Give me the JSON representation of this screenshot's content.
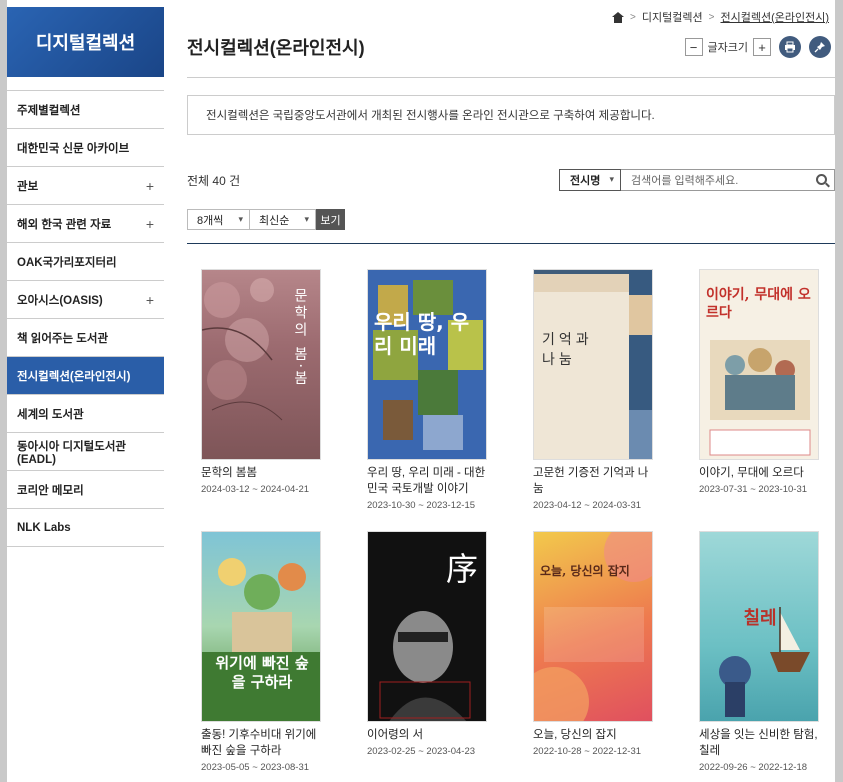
{
  "logo": "디지털컬렉션",
  "sidebar": {
    "items": [
      {
        "label": "주제별컬렉션",
        "plus": ""
      },
      {
        "label": "대한민국 신문 아카이브",
        "plus": ""
      },
      {
        "label": "관보",
        "plus": "+"
      },
      {
        "label": "해외 한국 관련 자료",
        "plus": "+"
      },
      {
        "label": "OAK국가리포지터리",
        "plus": ""
      },
      {
        "label": "오아시스(OASIS)",
        "plus": "+"
      },
      {
        "label": "책 읽어주는 도서관",
        "plus": ""
      },
      {
        "label": "전시컬렉션(온라인전시)",
        "plus": ""
      },
      {
        "label": "세계의 도서관",
        "plus": ""
      },
      {
        "label": "동아시아 디지털도서관(EADL)",
        "plus": ""
      },
      {
        "label": "코리안 메모리",
        "plus": ""
      },
      {
        "label": "NLK Labs",
        "plus": ""
      }
    ]
  },
  "breadcrumb": {
    "items": [
      "디지털컬렉션",
      "전시컬렉션(온라인전시)"
    ],
    "sep": ">"
  },
  "page": {
    "title": "전시컬렉션(온라인전시)",
    "font_size_label": "글자크기",
    "minus": "−",
    "plus": "+",
    "notice": "전시컬렉션은 국립중앙도서관에서 개최된 전시행사를 온라인 전시관으로 구축하여 제공합니다.",
    "total": "전체 40 건"
  },
  "search": {
    "field": "전시명",
    "placeholder": "검색어를 입력해주세요."
  },
  "filters": {
    "per_page": "8개씩",
    "sort": "최신순",
    "view": "보기"
  },
  "exhibits": [
    {
      "title": "문학의 봄봄",
      "dates": "2024-03-12 ~ 2024-04-21",
      "poster": "문학의 봄·봄"
    },
    {
      "title": "우리 땅, 우리 미래 - 대한민국 국토개발 이야기",
      "dates": "2023-10-30 ~ 2023-12-15",
      "poster": "우리 땅, 우리 미래"
    },
    {
      "title": "고문헌 기증전 기억과 나눔",
      "dates": "2023-04-12 ~ 2024-03-31",
      "poster": "기억과 나눔"
    },
    {
      "title": "이야기, 무대에 오르다",
      "dates": "2023-07-31 ~ 2023-10-31",
      "poster": "이야기, 무대에 오르다"
    },
    {
      "title": "출동! 기후수비대 위기에 빠진 숲을 구하라",
      "dates": "2023-05-05 ~ 2023-08-31",
      "poster": "위기에 빠진 숲을 구하라"
    },
    {
      "title": "이어령의 서",
      "dates": "2023-02-25 ~ 2023-04-23",
      "poster": "序"
    },
    {
      "title": "오늘, 당신의 잡지",
      "dates": "2022-10-28 ~ 2022-12-31",
      "poster": "오늘, 당신의 잡지"
    },
    {
      "title": "세상을 잇는 신비한 탐험, 칠레",
      "dates": "2022-09-26 ~ 2022-12-18",
      "poster": "칠레"
    }
  ]
}
